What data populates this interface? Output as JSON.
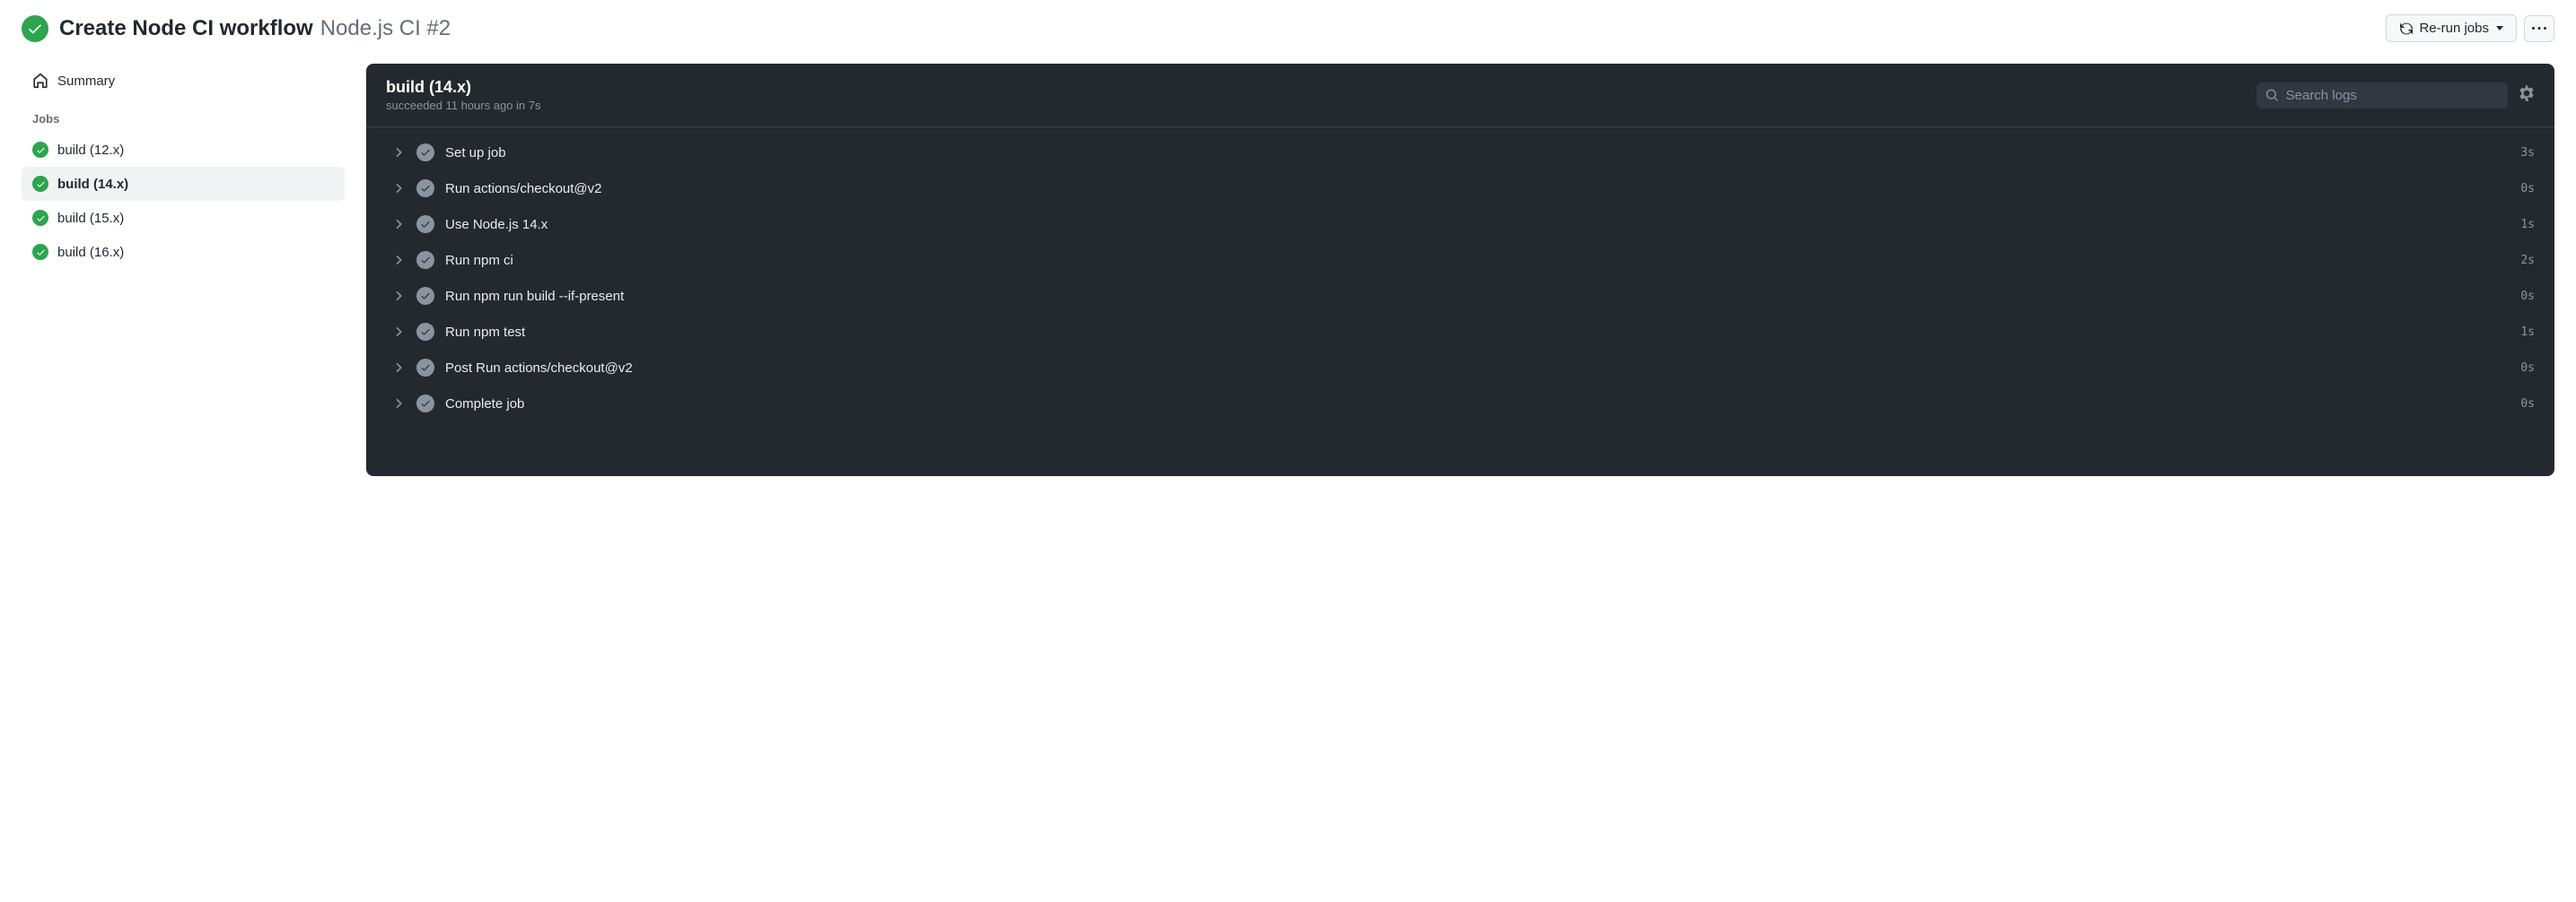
{
  "header": {
    "title": "Create Node CI workflow",
    "subtitle": "Node.js CI #2",
    "rerun_label": "Re-run jobs"
  },
  "sidebar": {
    "summary_label": "Summary",
    "jobs_heading": "Jobs",
    "jobs": [
      {
        "label": "build (12.x)",
        "selected": false
      },
      {
        "label": "build (14.x)",
        "selected": true
      },
      {
        "label": "build (15.x)",
        "selected": false
      },
      {
        "label": "build (16.x)",
        "selected": false
      }
    ]
  },
  "panel": {
    "title": "build (14.x)",
    "status": "succeeded 11 hours ago in 7s",
    "search_placeholder": "Search logs"
  },
  "steps": [
    {
      "name": "Set up job",
      "duration": "3s"
    },
    {
      "name": "Run actions/checkout@v2",
      "duration": "0s"
    },
    {
      "name": "Use Node.js 14.x",
      "duration": "1s"
    },
    {
      "name": "Run npm ci",
      "duration": "2s"
    },
    {
      "name": "Run npm run build --if-present",
      "duration": "0s"
    },
    {
      "name": "Run npm test",
      "duration": "1s"
    },
    {
      "name": "Post Run actions/checkout@v2",
      "duration": "0s"
    },
    {
      "name": "Complete job",
      "duration": "0s"
    }
  ]
}
